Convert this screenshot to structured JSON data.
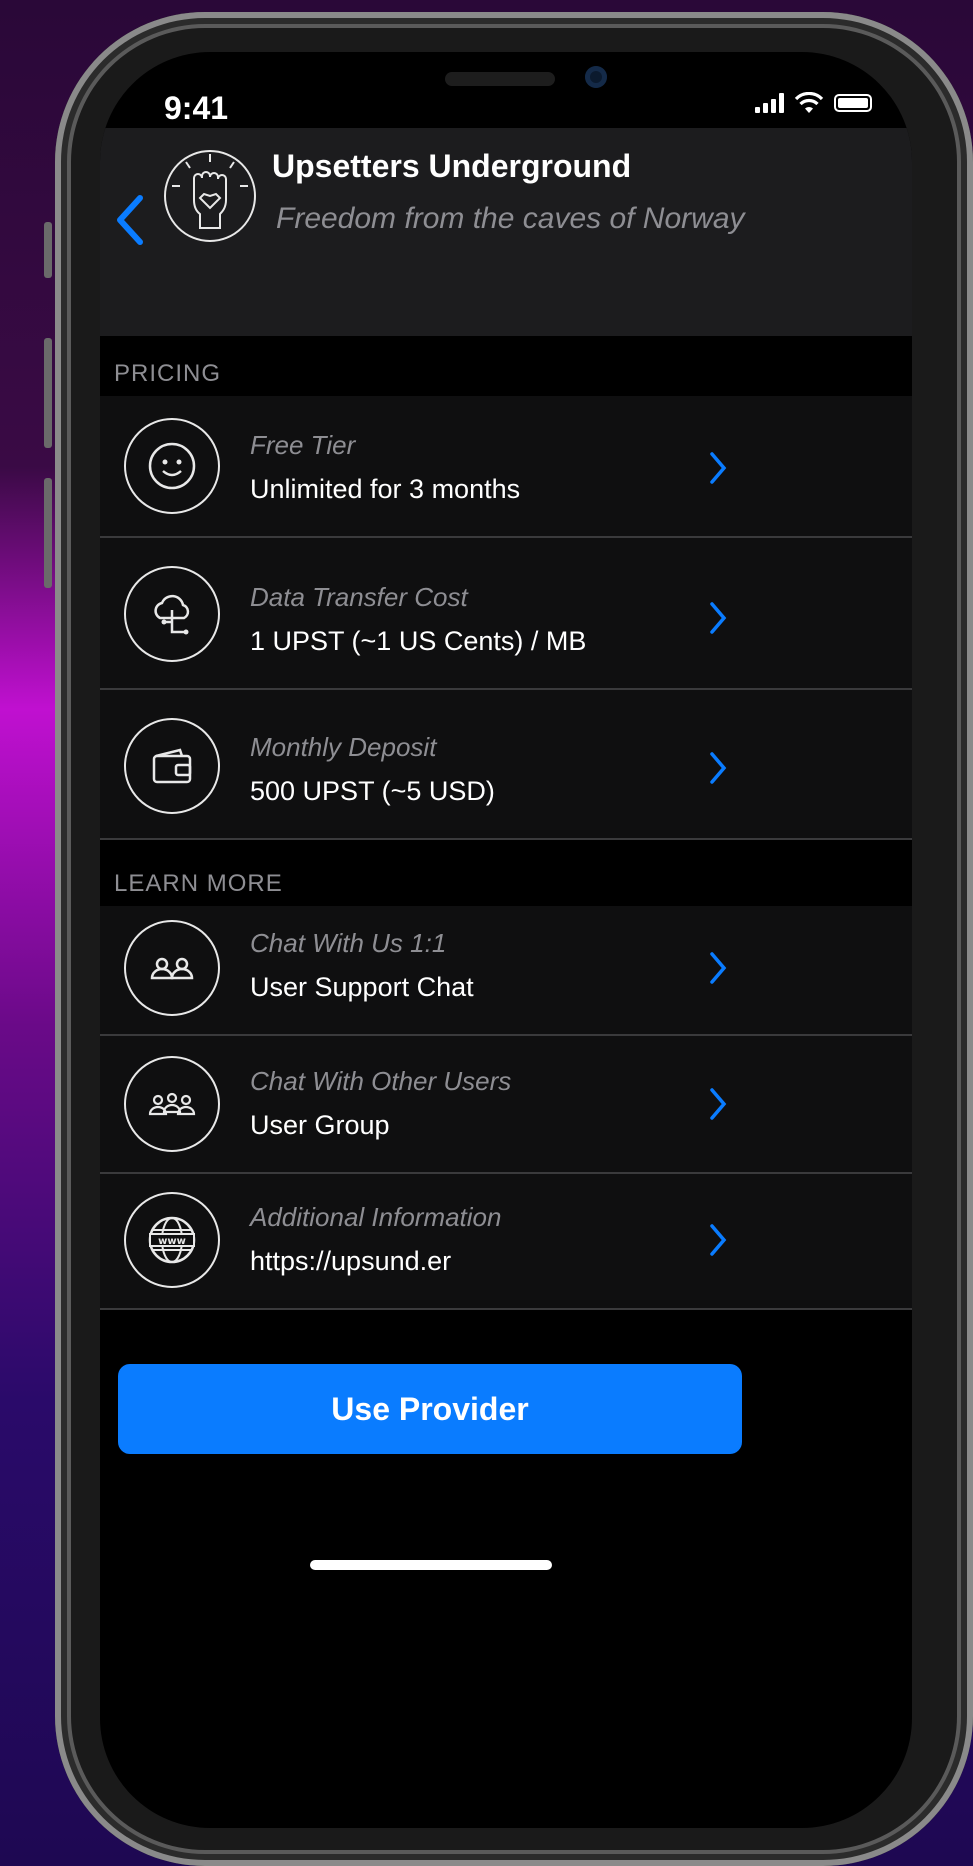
{
  "status_bar": {
    "time": "9:41"
  },
  "header": {
    "title": "Upsetters Underground",
    "subtitle": "Freedom from the caves of Norway"
  },
  "sections": [
    {
      "label": "PRICING",
      "rows": [
        {
          "icon": "smiley-icon",
          "caption": "Free Tier",
          "value": "Unlimited for 3 months"
        },
        {
          "icon": "cloud-transfer-icon",
          "caption": "Data Transfer Cost",
          "value": "1 UPST (~1 US Cents) / MB"
        },
        {
          "icon": "wallet-icon",
          "caption": "Monthly Deposit",
          "value": "500 UPST (~5 USD)"
        }
      ]
    },
    {
      "label": "LEARN MORE",
      "rows": [
        {
          "icon": "two-users-icon",
          "caption": "Chat With Us 1:1",
          "value": "User Support Chat"
        },
        {
          "icon": "user-group-icon",
          "caption": "Chat With Other Users",
          "value": "User Group"
        },
        {
          "icon": "www-globe-icon",
          "caption": "Additional Information",
          "value": "https://upsund.er"
        }
      ]
    }
  ],
  "cta": {
    "label": "Use Provider"
  },
  "colors": {
    "accent": "#0a7cff",
    "background": "#000000",
    "row_background": "#0f0f10"
  }
}
